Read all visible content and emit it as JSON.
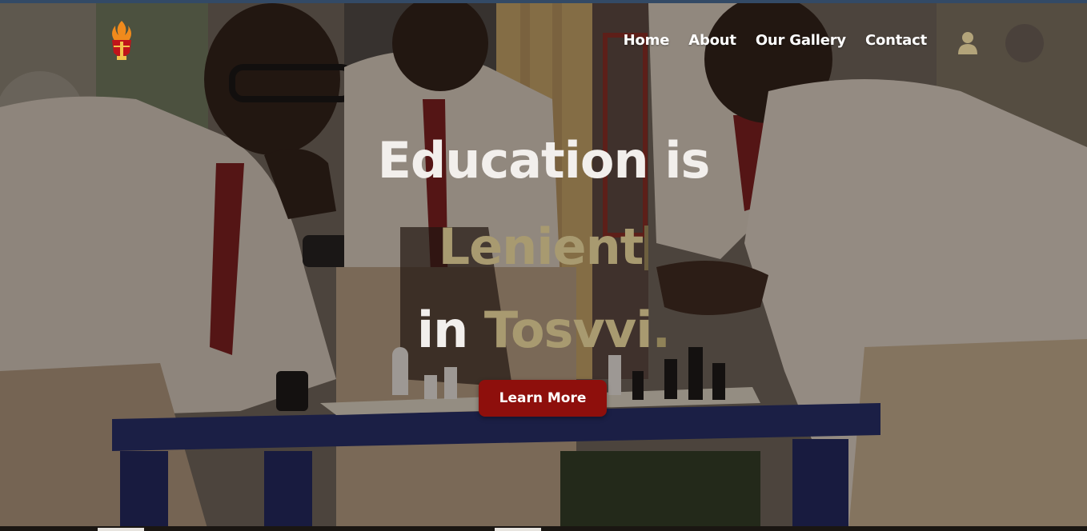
{
  "header": {
    "logo_icon": "torch-shield-logo-icon",
    "nav": [
      {
        "label": "Home"
      },
      {
        "label": "About"
      },
      {
        "label": "Our Gallery"
      },
      {
        "label": "Contact"
      }
    ],
    "user_icon": "user-icon"
  },
  "hero": {
    "line1": "Education is",
    "typed_word": "Lenient",
    "line3_prefix": "in",
    "line3_brand": "Tosvvi",
    "line3_period": ".",
    "cta_label": "Learn More"
  },
  "colors": {
    "accent_gold": "#a89a70",
    "cta_red": "#8e0f0c",
    "text_light": "#f2efec"
  }
}
